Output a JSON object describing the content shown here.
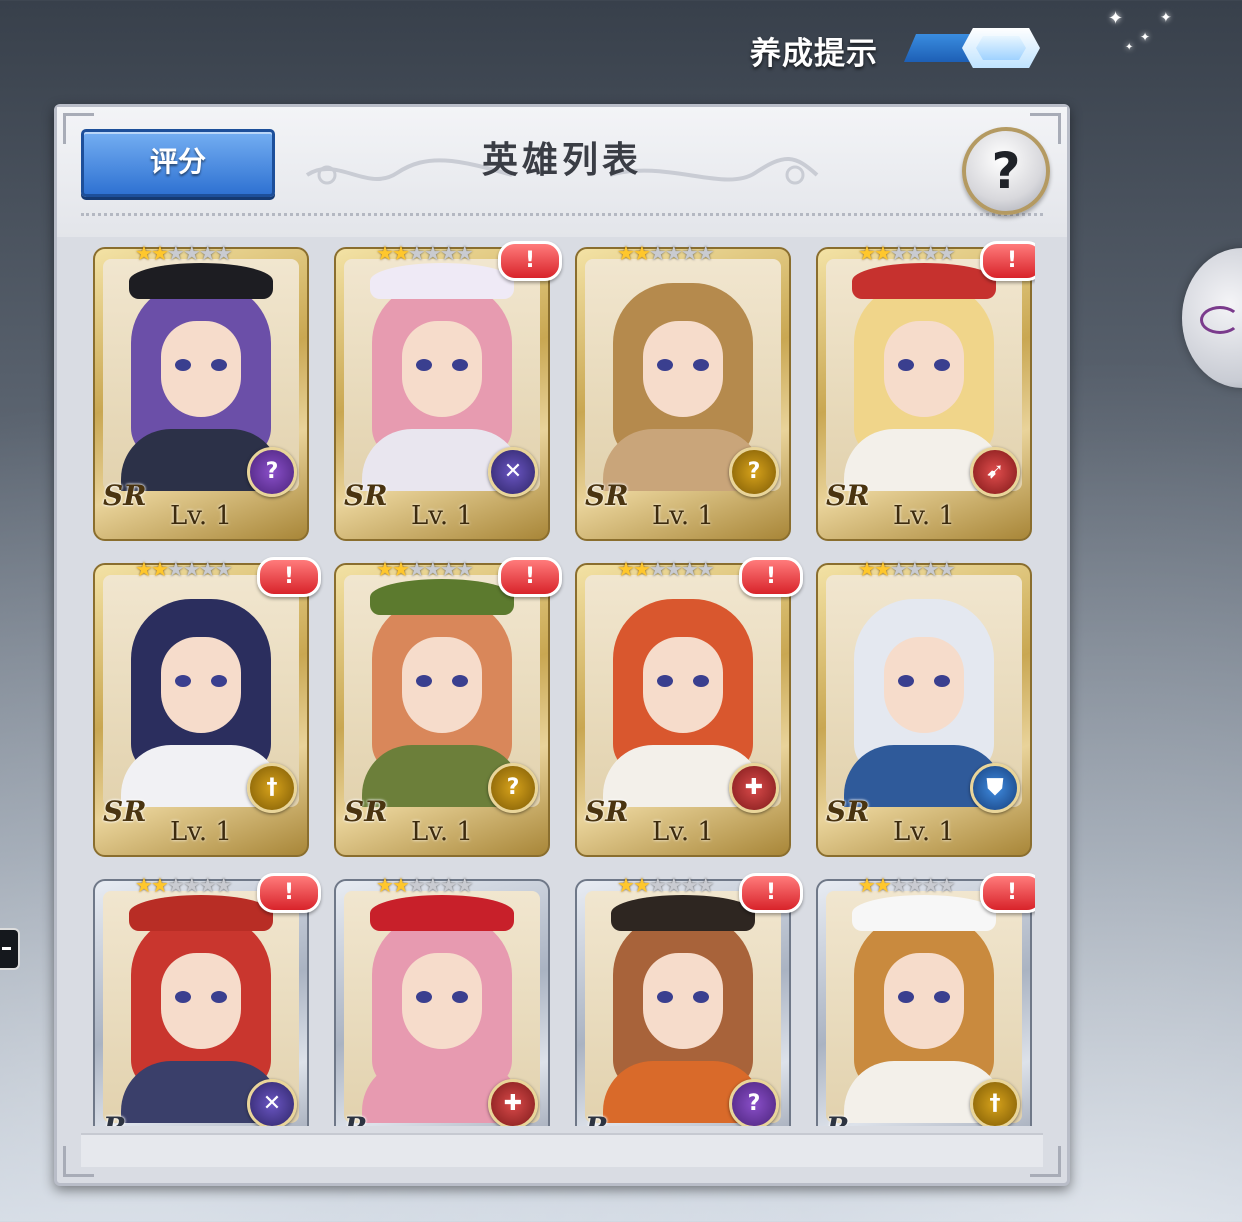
{
  "top": {
    "training_hint_label": "养成提示",
    "training_hint_on": true
  },
  "panel": {
    "score_button": "评分",
    "title": "英雄列表",
    "help_label": "?"
  },
  "heroes": [
    {
      "rarity": "SR",
      "level": "Lv. 1",
      "stars": 2,
      "max_stars": 6,
      "alert": false,
      "class_icon": "mage-icon",
      "hair": "#6b4fa8",
      "body": "#2c3148",
      "hat": "#1d1d22"
    },
    {
      "rarity": "SR",
      "level": "Lv. 1",
      "stars": 2,
      "max_stars": 6,
      "alert": true,
      "class_icon": "assassin-icon",
      "hair": "#e79bb0",
      "body": "#e9e6ef",
      "hat": "#efeaf6"
    },
    {
      "rarity": "SR",
      "level": "Lv. 1",
      "stars": 2,
      "max_stars": 6,
      "alert": false,
      "class_icon": "support-icon",
      "hair": "#b58a4d",
      "body": "#c9a57a",
      "hat": ""
    },
    {
      "rarity": "SR",
      "level": "Lv. 1",
      "stars": 2,
      "max_stars": 6,
      "alert": true,
      "class_icon": "archer-icon",
      "hair": "#f0d58a",
      "body": "#f3f0ea",
      "hat": "#c6312e"
    },
    {
      "rarity": "SR",
      "level": "Lv. 1",
      "stars": 2,
      "max_stars": 6,
      "alert": true,
      "class_icon": "warrior-icon",
      "hair": "#2b2e5e",
      "body": "#f1f1f4",
      "hat": ""
    },
    {
      "rarity": "SR",
      "level": "Lv. 1",
      "stars": 2,
      "max_stars": 6,
      "alert": true,
      "class_icon": "support-icon",
      "hair": "#d9875a",
      "body": "#6c7f3a",
      "hat": "#5c7a2e"
    },
    {
      "rarity": "SR",
      "level": "Lv. 1",
      "stars": 2,
      "max_stars": 6,
      "alert": true,
      "class_icon": "healer-icon",
      "hair": "#d9572e",
      "body": "#f3f0ea",
      "hat": ""
    },
    {
      "rarity": "SR",
      "level": "Lv. 1",
      "stars": 2,
      "max_stars": 6,
      "alert": false,
      "class_icon": "tank-icon",
      "hair": "#e4e8f0",
      "body": "#2f5a9a",
      "hat": ""
    },
    {
      "rarity": "R",
      "level": "",
      "stars": 2,
      "max_stars": 6,
      "alert": true,
      "class_icon": "assassin-icon",
      "hair": "#c9362e",
      "body": "#3a3f6a",
      "hat": "#b82d25"
    },
    {
      "rarity": "R",
      "level": "",
      "stars": 2,
      "max_stars": 6,
      "alert": false,
      "class_icon": "healer-icon",
      "hair": "#e79ab0",
      "body": "#e79ab0",
      "hat": "#c8202a"
    },
    {
      "rarity": "R",
      "level": "",
      "stars": 2,
      "max_stars": 6,
      "alert": true,
      "class_icon": "mage-icon",
      "hair": "#a8633a",
      "body": "#d96a2a",
      "hat": "#2e2621"
    },
    {
      "rarity": "R",
      "level": "",
      "stars": 2,
      "max_stars": 6,
      "alert": true,
      "class_icon": "warrior-icon",
      "hair": "#c98a3e",
      "body": "#f3f0ea",
      "hat": "#f7f7f7"
    }
  ]
}
